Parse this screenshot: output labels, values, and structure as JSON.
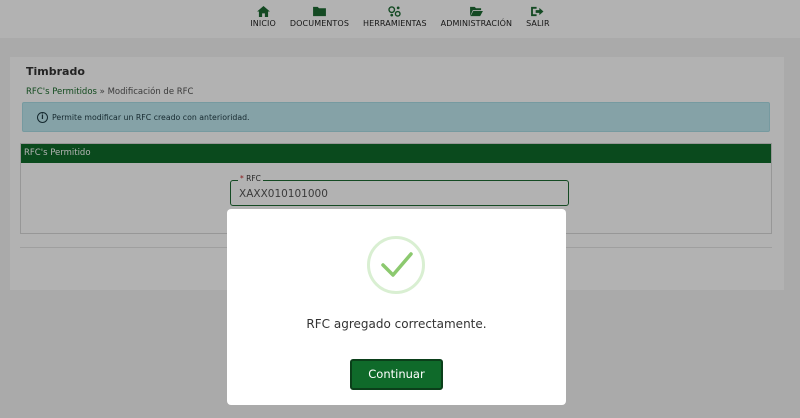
{
  "nav": {
    "items": [
      {
        "label": "INICIO",
        "icon": "home-icon"
      },
      {
        "label": "DOCUMENTOS",
        "icon": "folder-icon"
      },
      {
        "label": "HERRAMIENTAS",
        "icon": "tools-icon"
      },
      {
        "label": "ADMINISTRACIÓN",
        "icon": "folder-open-icon"
      },
      {
        "label": "SALIR",
        "icon": "logout-icon"
      }
    ]
  },
  "page": {
    "title": "Timbrado",
    "breadcrumb": {
      "link": "RFC's Permitidos",
      "separator": " » ",
      "current": "Modificación de RFC"
    },
    "info": "Permite modificar un RFC creado con anterioridad.",
    "section_title": "RFC's Permitido",
    "rfc_label": "RFC",
    "rfc_required_mark": "*",
    "rfc_value": "XAXX010101000"
  },
  "modal": {
    "message": "RFC agregado correctamente.",
    "button": "Continuar",
    "icon": "check-icon"
  },
  "colors": {
    "brand_green": "#0f6a2a",
    "info_bg": "#bfe8ef"
  }
}
